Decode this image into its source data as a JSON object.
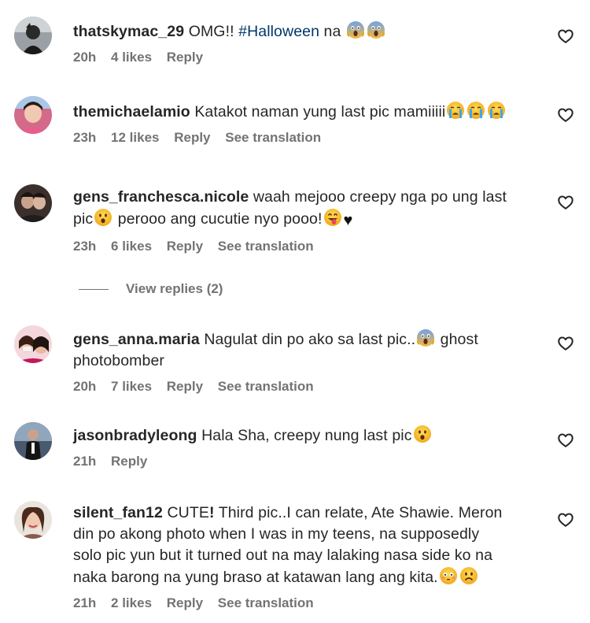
{
  "comments": [
    {
      "username": "thatskymac_29",
      "text_before": "OMG!! ",
      "hashtag": "#Halloween",
      "text_after": " na",
      "emojis": [
        "scream-emoji",
        "scream-emoji"
      ],
      "time": "20h",
      "likes": "4 likes",
      "reply": "Reply"
    },
    {
      "username": "themichaelamio",
      "text": "Katakot naman yung last pic mamiiiii",
      "emojis": [
        "crying-emoji",
        "crying-emoji",
        "crying-emoji"
      ],
      "time": "23h",
      "likes": "12 likes",
      "reply": "Reply",
      "translation": "See translation"
    },
    {
      "username": "gens_franchesca.nicole",
      "text_line1": "waah mejooo creepy nga po ung last",
      "text_line2a": "pic",
      "text_line2b": " perooo ang cucutie nyo pooo!",
      "emojis": [
        "surprised-emoji",
        "tongue-emoji",
        "black-heart-emoji"
      ],
      "time": "23h",
      "likes": "6 likes",
      "reply": "Reply",
      "translation": "See translation",
      "view_replies": "View replies (2)"
    },
    {
      "username": "gens_anna.maria",
      "text_line1": "Nagulat din po ako sa last pic..",
      "text_line1b": " ghost",
      "text_line2": "photobomber",
      "emojis": [
        "scream-emoji"
      ],
      "time": "20h",
      "likes": "7 likes",
      "reply": "Reply",
      "translation": "See translation"
    },
    {
      "username": "jasonbradyleong",
      "text": "Hala Sha, creepy nung last pic",
      "emojis": [
        "surprised-emoji"
      ],
      "time": "21h",
      "reply": "Reply"
    },
    {
      "username": "silent_fan12",
      "text_line1a": "CUTE",
      "text_line1b": " Third pic..I can relate, Ate Shawie. Meron",
      "text_line2": "din po akong photo when I was in my teens, na supposedly",
      "text_line3": "solo pic yun but it turned out na may lalaking nasa side ko na",
      "text_line4": "naka barong na yung braso at katawan lang ang kita.",
      "emojis": [
        "exclamation-mark",
        "flushed-emoji",
        "frowning-emoji"
      ],
      "time": "21h",
      "likes": "2 likes",
      "reply": "Reply",
      "translation": "See translation"
    }
  ],
  "colors": {
    "text": "#262626",
    "meta": "#737373",
    "hashtag": "#00376b",
    "emoji_yellow": "#f8c23c",
    "emoji_blue": "#5b8ed8"
  }
}
